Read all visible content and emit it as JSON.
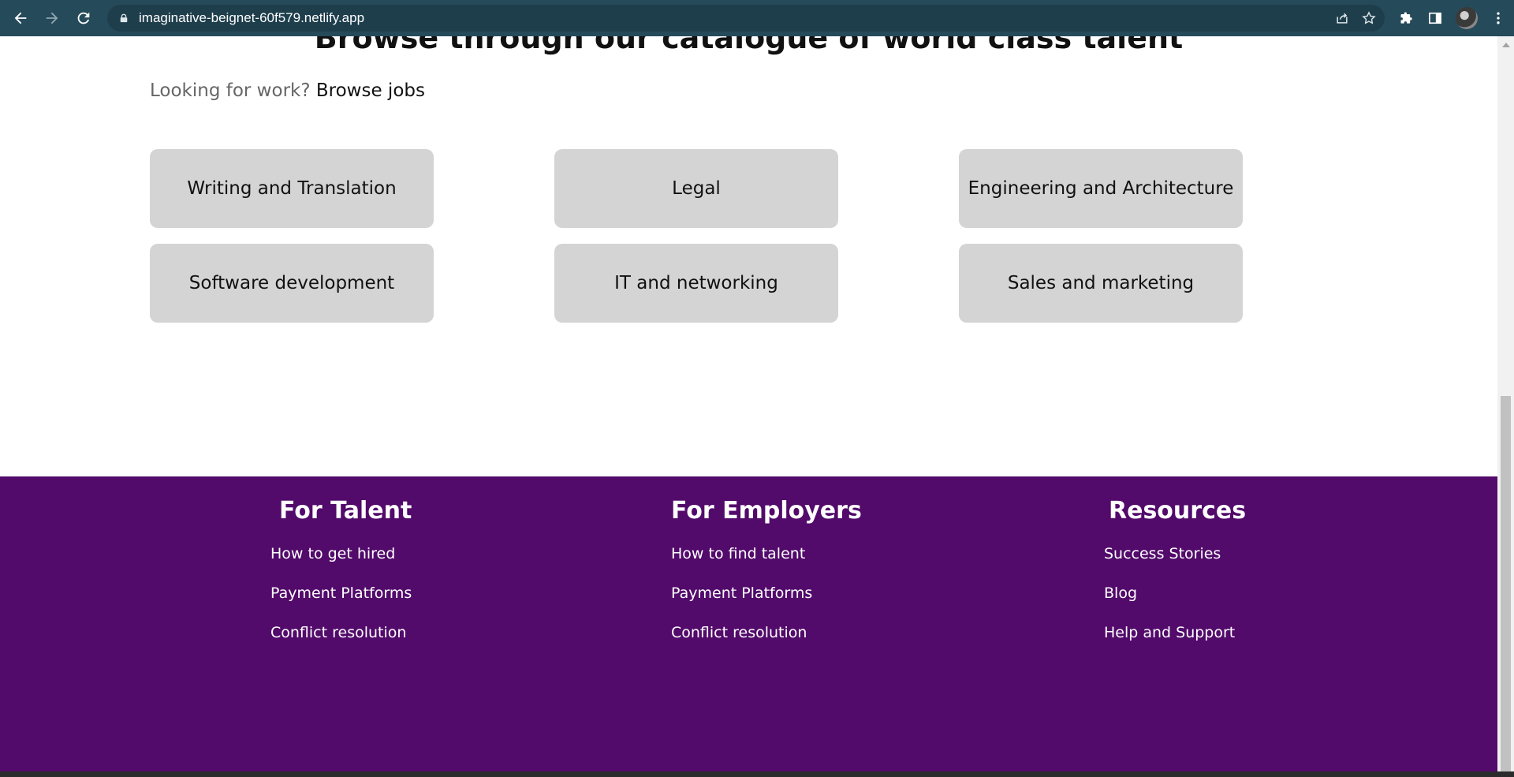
{
  "browser": {
    "url": "imaginative-beignet-60f579.netlify.app"
  },
  "page": {
    "headline": "Browse through our catalogue of world class talent",
    "looking_text": "Looking for work?",
    "browse_jobs_link": "Browse jobs",
    "categories": [
      "Writing and Translation",
      "Legal",
      "Engineering and Architecture",
      "Software development",
      "IT and networking",
      "Sales and marketing"
    ]
  },
  "footer": {
    "talent": {
      "title": "For Talent",
      "links": [
        "How to get hired",
        "Payment Platforms",
        "Conflict resolution"
      ]
    },
    "employers": {
      "title": "For Employers",
      "links": [
        "How to find talent",
        "Payment Platforms",
        "Conflict resolution"
      ]
    },
    "resources": {
      "title": "Resources",
      "links": [
        "Success Stories",
        "Blog",
        "Help and Support"
      ]
    }
  },
  "colors": {
    "chrome": "#254a5a",
    "footer_bg": "#520a6b",
    "category_bg": "#d4d4d4"
  },
  "icons": [
    "back-arrow-icon",
    "forward-arrow-icon",
    "reload-icon",
    "lock-icon",
    "share-icon",
    "star-icon",
    "extensions-icon",
    "side-panel-icon",
    "profile-avatar",
    "more-menu-icon"
  ]
}
